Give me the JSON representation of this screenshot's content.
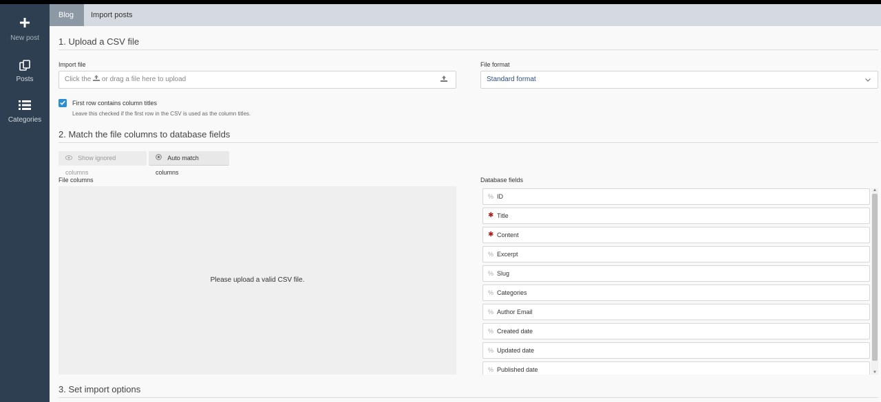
{
  "sidebar": {
    "items": [
      {
        "label": "New post",
        "icon": "plus-icon"
      },
      {
        "label": "Posts",
        "icon": "copy-icon"
      },
      {
        "label": "Categories",
        "icon": "list-icon"
      }
    ]
  },
  "breadcrumb": {
    "root": "Blog",
    "current": "Import posts"
  },
  "section1": {
    "title": "1. Upload a CSV file",
    "import_file_label": "Import file",
    "upload_placeholder_pre": "Click the",
    "upload_placeholder_post": "or drag a file here to upload",
    "file_format_label": "File format",
    "file_format_value": "Standard format",
    "checkbox_label": "First row contains column titles",
    "checkbox_help": "Leave this checked if the first row in the CSV is used as the column titles."
  },
  "section2": {
    "title": "2. Match the file columns to database fields",
    "show_ignored_label": "Show ignored columns",
    "auto_match_label": "Auto match columns",
    "file_columns_label": "File columns",
    "file_columns_message": "Please upload a valid CSV file.",
    "database_fields_label": "Database fields",
    "fields": [
      {
        "label": "ID",
        "required": false
      },
      {
        "label": "Title",
        "required": true
      },
      {
        "label": "Content",
        "required": true
      },
      {
        "label": "Excerpt",
        "required": false
      },
      {
        "label": "Slug",
        "required": false
      },
      {
        "label": "Categories",
        "required": false
      },
      {
        "label": "Author Email",
        "required": false
      },
      {
        "label": "Created date",
        "required": false
      },
      {
        "label": "Updated date",
        "required": false
      },
      {
        "label": "Published date",
        "required": false
      }
    ]
  },
  "section3": {
    "title": "3. Set import options"
  },
  "colors": {
    "sidebar_bg": "#2e3f51",
    "accent": "#2b8ed1",
    "required": "#b01c1c"
  }
}
